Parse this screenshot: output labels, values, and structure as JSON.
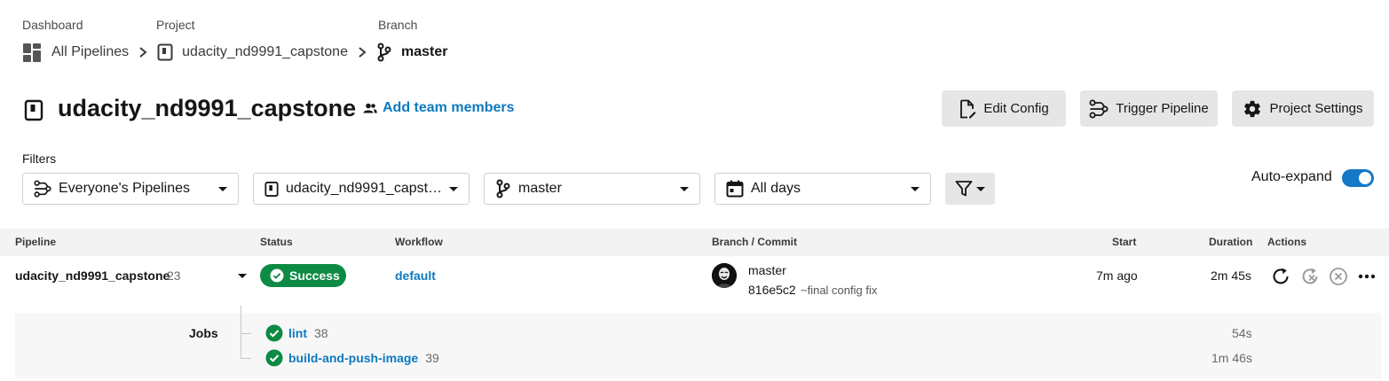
{
  "breadcrumb": {
    "dashboard_caption": "Dashboard",
    "dashboard_label": "All Pipelines",
    "project_caption": "Project",
    "project_label": "udacity_nd9991_capstone",
    "branch_caption": "Branch",
    "branch_label": "master"
  },
  "header": {
    "title": "udacity_nd9991_capstone",
    "add_team_label": "Add team members",
    "buttons": {
      "edit_config": "Edit Config",
      "trigger_pipeline": "Trigger Pipeline",
      "project_settings": "Project Settings"
    }
  },
  "filters": {
    "label": "Filters",
    "pipelines": "Everyone's Pipelines",
    "project": "udacity_nd9991_capst…",
    "branch": "master",
    "days": "All days",
    "auto_expand_label": "Auto-expand",
    "auto_expand_on": true
  },
  "table": {
    "headers": [
      "Pipeline",
      "Status",
      "Workflow",
      "Branch / Commit",
      "Start",
      "Duration",
      "Actions"
    ],
    "row": {
      "pipeline_name": "udacity_nd9991_capstone",
      "pipeline_number": "23",
      "status": "Success",
      "workflow": "default",
      "branch": "master",
      "commit_hash": "816e5c2",
      "commit_message": "~final config fix",
      "start": "7m ago",
      "duration": "2m 45s"
    },
    "jobs_label": "Jobs",
    "jobs": [
      {
        "name": "lint",
        "number": "38",
        "duration": "54s",
        "status": "success"
      },
      {
        "name": "build-and-push-image",
        "number": "39",
        "duration": "1m 46s",
        "status": "success"
      }
    ]
  },
  "colors": {
    "accent": "#0e79c0",
    "success": "#0d8a43",
    "toggle": "#1479c9"
  },
  "icons": [
    "dashboard-icon",
    "project-icon",
    "branch-icon",
    "team-icon",
    "edit-config-icon",
    "trigger-icon",
    "gear-icon",
    "calendar-icon",
    "filter-icon",
    "rerun-icon",
    "rerun-failed-icon",
    "cancel-icon",
    "more-icon",
    "check-icon"
  ]
}
